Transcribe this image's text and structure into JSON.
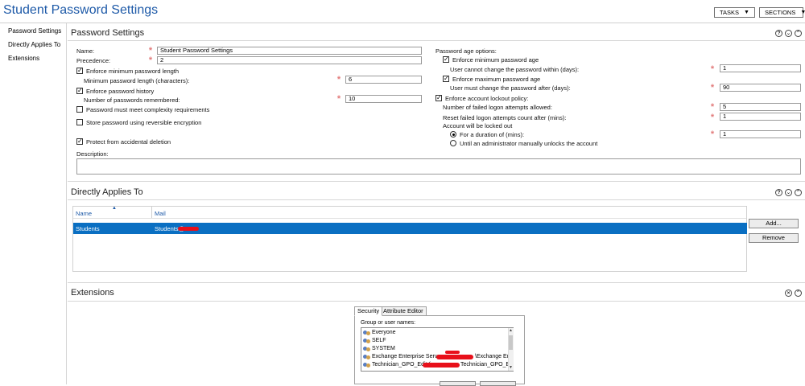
{
  "window": {
    "title": "Student Password Settings",
    "tasks_label": "TASKS",
    "sections_label": "SECTIONS"
  },
  "nav": {
    "items": [
      "Password Settings",
      "Directly Applies To",
      "Extensions"
    ]
  },
  "password_settings": {
    "title": "Password Settings",
    "name_label": "Name:",
    "name_value": "Student Password Settings",
    "precedence_label": "Precedence:",
    "precedence_value": "2",
    "enforce_min_length": {
      "label": "Enforce minimum password length",
      "checked": true
    },
    "min_length_label": "Minimum password length (characters):",
    "min_length_value": "6",
    "enforce_history": {
      "label": "Enforce password history",
      "checked": true
    },
    "remembered_label": "Number of passwords remembered:",
    "remembered_value": "10",
    "complexity": {
      "label": "Password must meet complexity requirements",
      "checked": false
    },
    "reversible": {
      "label": "Store password using reversible encryption",
      "checked": false
    },
    "protect": {
      "label": "Protect from accidental deletion",
      "checked": true
    },
    "description_label": "Description:",
    "description_value": "",
    "age_options_label": "Password age options:",
    "enforce_min_age": {
      "label": "Enforce minimum password age",
      "checked": true
    },
    "min_age_label": "User cannot change the password within (days):",
    "min_age_value": "1",
    "enforce_max_age": {
      "label": "Enforce maximum password age",
      "checked": true
    },
    "max_age_label": "User must change the password after (days):",
    "max_age_value": "90",
    "enforce_lockout": {
      "label": "Enforce account lockout policy:",
      "checked": true
    },
    "failed_attempts_label": "Number of failed logon attempts allowed:",
    "failed_attempts_value": "5",
    "reset_count_label": "Reset failed logon attempts count after (mins):",
    "reset_count_value": "1",
    "locked_out_label": "Account will be locked out",
    "duration_option": {
      "label": "For a duration of (mins):",
      "selected": true
    },
    "duration_value": "1",
    "manual_unlock_option": {
      "label": "Until an administrator manually unlocks the account",
      "selected": false
    }
  },
  "directly_applies": {
    "title": "Directly Applies To",
    "columns": [
      "Name",
      "Mail"
    ],
    "rows": [
      {
        "name": "Students",
        "mail": "Students@"
      }
    ],
    "add_label": "Add...",
    "remove_label": "Remove"
  },
  "extensions": {
    "title": "Extensions",
    "tabs": [
      "Security",
      "Attribute Editor"
    ],
    "group_label": "Group or user names:",
    "entries": [
      "Everyone",
      "SELF",
      "SYSTEM",
      "Exchange Enterprise Servers",
      "\\Exchange Ent",
      "Technician_GPO_Edit (",
      "Technician_GPO_E"
    ]
  },
  "icons": {
    "help": "help-circle-icon",
    "collapse": "collapse-up-icon",
    "close": "close-circle-icon",
    "required": "required-asterisk-icon",
    "user_group": "user-group-icon"
  },
  "colors": {
    "title_blue": "#1e5aa8",
    "selection_blue": "#0a6fc2",
    "required_red": "#e27b7b"
  }
}
